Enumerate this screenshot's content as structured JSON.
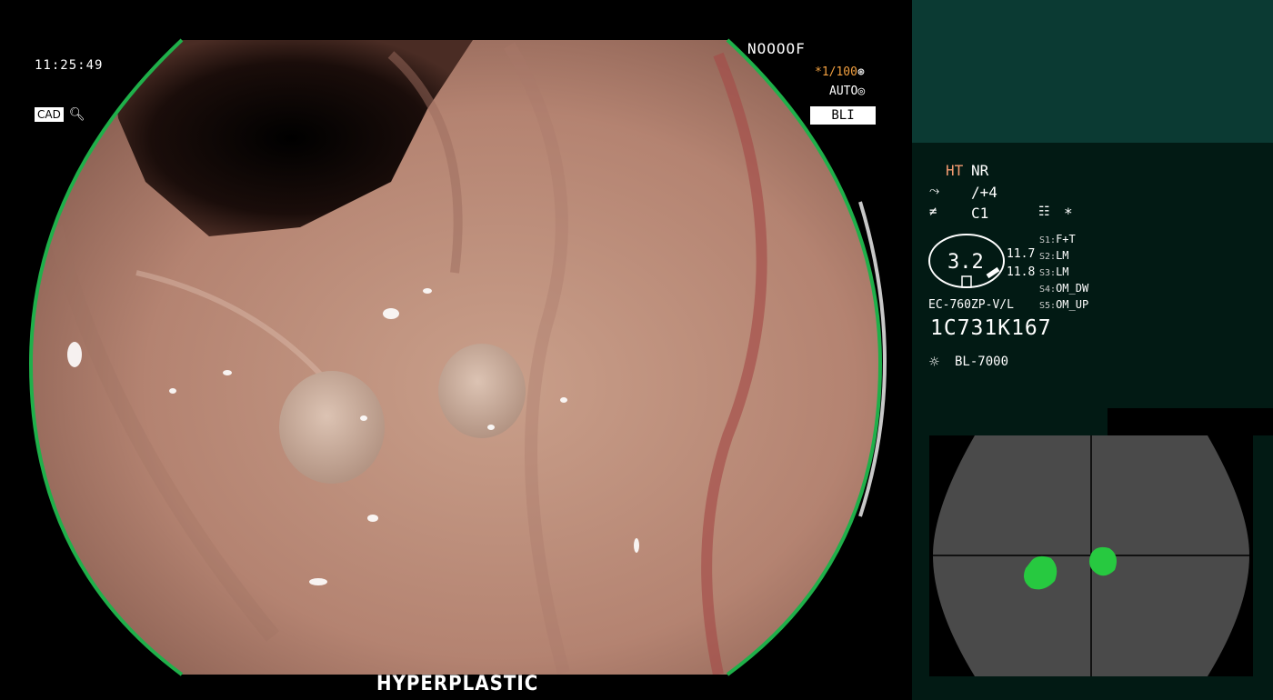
{
  "overlay": {
    "time": "11:25:49",
    "cad_label": "CAD",
    "mag_icon": "magnifier-icon",
    "patient_id": "NOOOOF",
    "shutter": "*1/100",
    "iris_mode": "AUTO",
    "light_mode": "BLI",
    "classification": "HYPERPLASTIC"
  },
  "panel": {
    "ht": "HT",
    "nr": "NR",
    "enhance": "/+4",
    "color": "C1",
    "star": "*",
    "gauge_value": "3.2",
    "value_top": "11.7",
    "value_bottom": "11.8",
    "switches": [
      {
        "key": "S1:",
        "value": "F+T"
      },
      {
        "key": "S2:",
        "value": "LM"
      },
      {
        "key": "S3:",
        "value": "LM"
      },
      {
        "key": "S4:",
        "value": "OM_DW"
      },
      {
        "key": "S5:",
        "value": "OM_UP"
      }
    ],
    "scope_model": "EC-760ZP-V/L",
    "serial": "1C731K167",
    "light_source": "BL-7000"
  },
  "colors": {
    "ring_green": "#1fb04a",
    "detection_green": "#27c940",
    "panel_bg": "#021a14",
    "panel_top": "#0b3a33",
    "shutter_orange": "#f2a040",
    "ht_orange": "#f29a70"
  }
}
